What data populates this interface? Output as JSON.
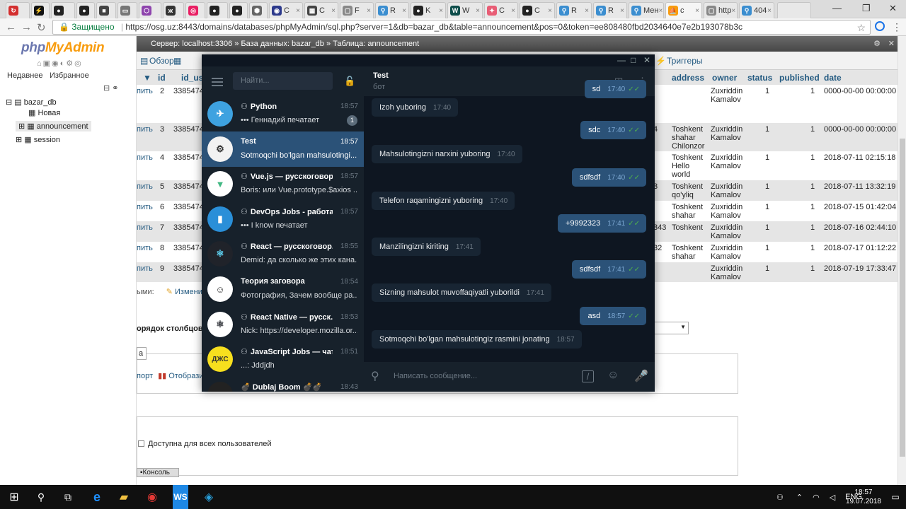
{
  "browser": {
    "tabs": [
      {
        "label": "",
        "color": "#d32f2f",
        "glyph": "↻",
        "active": false
      },
      {
        "label": "",
        "color": "#111",
        "glyph": "⚡",
        "active": false
      },
      {
        "label": "",
        "color": "#222",
        "glyph": "●",
        "active": false
      },
      {
        "label": "",
        "color": "#222",
        "glyph": "●",
        "active": false
      },
      {
        "label": "",
        "color": "#444",
        "glyph": "■",
        "active": false
      },
      {
        "label": "",
        "color": "#777",
        "glyph": "▭",
        "active": false
      },
      {
        "label": "",
        "color": "#8e44ad",
        "glyph": "⬡",
        "active": false
      },
      {
        "label": "",
        "color": "#333",
        "glyph": "ж",
        "active": false
      },
      {
        "label": "",
        "color": "#e91e63",
        "glyph": "◎",
        "active": false
      },
      {
        "label": "",
        "color": "#222",
        "glyph": "●",
        "active": false
      },
      {
        "label": "",
        "color": "#222",
        "glyph": "●",
        "active": false
      },
      {
        "label": "",
        "color": "#666",
        "glyph": "⬢",
        "active": false
      },
      {
        "label": "C",
        "color": "#2d3a8c",
        "glyph": "◉",
        "active": false
      },
      {
        "label": "C",
        "color": "#444",
        "glyph": "▦",
        "active": false
      },
      {
        "label": "F",
        "color": "#888",
        "glyph": "▢",
        "active": false
      },
      {
        "label": "R",
        "color": "#3b8ed0",
        "glyph": "⚲",
        "active": false
      },
      {
        "label": "K",
        "color": "#222",
        "glyph": "●",
        "active": false
      },
      {
        "label": "W",
        "color": "#0d4d4a",
        "glyph": "W",
        "active": false
      },
      {
        "label": "C",
        "color": "#e85d75",
        "glyph": "✦",
        "active": false
      },
      {
        "label": "C",
        "color": "#222",
        "glyph": "●",
        "active": false
      },
      {
        "label": "R",
        "color": "#3b8ed0",
        "glyph": "⚲",
        "active": false
      },
      {
        "label": "R",
        "color": "#3b8ed0",
        "glyph": "⚲",
        "active": false
      },
      {
        "label": "Мен",
        "color": "#3b8ed0",
        "glyph": "⚲",
        "active": false
      },
      {
        "label": "c",
        "color": "#f89c0e",
        "glyph": "⛵",
        "active": true
      },
      {
        "label": "http",
        "color": "#888",
        "glyph": "▢",
        "active": false
      },
      {
        "label": "404",
        "color": "#3b8ed0",
        "glyph": "⚲",
        "active": false
      }
    ],
    "secure_label": "Защищено",
    "url": "https://osg.uz:8443/domains/databases/phpMyAdmin/sql.php?server=1&db=bazar_db&table=announcement&pos=0&token=ee808480fbd2034640e7e2b193078b3c"
  },
  "pma": {
    "logo_a": "php",
    "logo_b": "MyAdmin",
    "recent": "Недавнее",
    "favorites": "Избранное",
    "tree": [
      "bazar_db",
      "Новая",
      "announcement",
      "session"
    ],
    "breadcrumb": "Сервер: localhost:3306 » База данных: bazar_db » Таблица: announcement",
    "tab_browse": "Обзор",
    "tab_triggers": "Триггеры",
    "columns": [
      "id",
      "id_us",
      "address",
      "owner",
      "status",
      "published",
      "date"
    ],
    "rows": [
      {
        "edit": "пить",
        "id": "2",
        "uid": "3385474",
        "addr_pre": "",
        "addr": "",
        "owner": "Zuxriddin Kamalov",
        "status": "1",
        "pub": "1",
        "date": "0000-00-00 00:00:00"
      },
      {
        "edit": "пить",
        "id": "3",
        "uid": "3385474",
        "addr_pre": "4",
        "addr": "Toshkent shahar Chilonzor",
        "owner": "Zuxriddin Kamalov",
        "status": "1",
        "pub": "1",
        "date": "0000-00-00 00:00:00"
      },
      {
        "edit": "пить",
        "id": "4",
        "uid": "3385474",
        "addr_pre": "",
        "addr": "Toshkent Hello world",
        "owner": "Zuxriddin Kamalov",
        "status": "1",
        "pub": "1",
        "date": "2018-07-11 02:15:18"
      },
      {
        "edit": "пить",
        "id": "5",
        "uid": "3385474",
        "addr_pre": "3",
        "addr": "Toshkent qo'yliq",
        "owner": "Zuxriddin Kamalov",
        "status": "1",
        "pub": "1",
        "date": "2018-07-11 13:32:19"
      },
      {
        "edit": "пить",
        "id": "6",
        "uid": "3385474",
        "addr_pre": "",
        "addr": "Toshkent shahar",
        "owner": "Zuxriddin Kamalov",
        "status": "1",
        "pub": "1",
        "date": "2018-07-15 01:42:04"
      },
      {
        "edit": "пить",
        "id": "7",
        "uid": "3385474",
        "addr_pre": "343",
        "addr": "Toshkent",
        "owner": "Zuxriddin Kamalov",
        "status": "1",
        "pub": "1",
        "date": "2018-07-16 02:44:10"
      },
      {
        "edit": "пить",
        "id": "8",
        "uid": "3385474",
        "addr_pre": "32",
        "addr": "Toshkent shahar",
        "owner": "Zuxriddin Kamalov",
        "status": "1",
        "pub": "1",
        "date": "2018-07-17 01:12:22"
      },
      {
        "edit": "пить",
        "id": "9",
        "uid": "3385474",
        "addr_pre": "",
        "addr": "",
        "owner": "Zuxriddin Kamalov",
        "status": "1",
        "pub": "1",
        "date": "2018-07-19 17:33:47"
      }
    ],
    "below_label": "ыми:",
    "below_edit": "Изменит",
    "order_label": "орядок столбцов",
    "box_a": "а",
    "export_label": "порт",
    "display_label": "Отобрази",
    "public_label": "Доступна для всех пользователей",
    "console_label": "Консоль"
  },
  "telegram": {
    "search_placeholder": "Найти...",
    "chats": [
      {
        "name": "Python",
        "group": true,
        "time": "18:57",
        "preview": "••• Геннадий печатает",
        "badge": "1",
        "avbg": "#3ea2e0",
        "avfg": "#fff",
        "avtext": "✈"
      },
      {
        "name": "Test",
        "group": false,
        "time": "18:57",
        "preview": "Sotmoqchi bo'lgan mahsulotingi...",
        "badge": "",
        "avbg": "#f2f2f2",
        "avfg": "#333",
        "avtext": "⚙",
        "sel": true
      },
      {
        "name": "Vue.js — русскоговор...",
        "group": true,
        "time": "18:57",
        "preview": "Boris: или Vue.prototype.$axios ...",
        "badge": "",
        "avbg": "#fff",
        "avfg": "#41b883",
        "avtext": "▼"
      },
      {
        "name": "DevOps Jobs - работа ...",
        "group": true,
        "time": "18:57",
        "preview": "••• I know печатает",
        "badge": "",
        "avbg": "#2a8fd8",
        "avfg": "#fff",
        "avtext": "▮"
      },
      {
        "name": "React — русскоговор...",
        "group": true,
        "time": "18:55",
        "preview": "Demid: да сколько же этих кана...",
        "badge": "",
        "avbg": "#20232a",
        "avfg": "#61dafb",
        "avtext": "⚛"
      },
      {
        "name": "Теория заговора",
        "group": false,
        "time": "18:54",
        "preview": "Фотография, Зачем вообще ра...",
        "badge": "",
        "avbg": "#fff",
        "avfg": "#333",
        "avtext": "☺"
      },
      {
        "name": "React Native — русск...",
        "group": true,
        "time": "18:53",
        "preview": "Nick: https://developer.mozilla.or...",
        "badge": "",
        "avbg": "#fff",
        "avfg": "#20232a",
        "avtext": "⚛"
      },
      {
        "name": "JavaScript Jobs — чат",
        "group": true,
        "time": "18:51",
        "preview": "...: Jddjdh",
        "badge": "",
        "avbg": "#f7df1e",
        "avfg": "#333",
        "avtext": "ДЖС"
      },
      {
        "name": "💣 Dublaj Boom 💣💣",
        "group": false,
        "time": "18:43",
        "preview": "",
        "badge": "",
        "avbg": "#222",
        "avfg": "#fff",
        "avtext": "●"
      }
    ],
    "chat_name": "Test",
    "chat_status": "бот",
    "messages": [
      {
        "dir": "out",
        "text": "sd",
        "time": "17:40"
      },
      {
        "dir": "in",
        "text": "Izoh yuboring",
        "time": "17:40"
      },
      {
        "dir": "out",
        "text": "sdc",
        "time": "17:40"
      },
      {
        "dir": "in",
        "text": "Mahsulotingizni narxini yuboring",
        "time": "17:40"
      },
      {
        "dir": "out",
        "text": "sdfsdf",
        "time": "17:40"
      },
      {
        "dir": "in",
        "text": "Telefon raqamingizni yuboring",
        "time": "17:40"
      },
      {
        "dir": "out",
        "text": "+9992323",
        "time": "17:41"
      },
      {
        "dir": "in",
        "text": "Manzilingizni kiriting",
        "time": "17:41"
      },
      {
        "dir": "out",
        "text": "sdfsdf",
        "time": "17:41"
      },
      {
        "dir": "in",
        "text": "Sizning mahsulot muvoffaqiyatli yuborildi",
        "time": "17:41"
      },
      {
        "dir": "out",
        "text": "asd",
        "time": "18:57"
      },
      {
        "dir": "in",
        "text": "Sotmoqchi bo'lgan mahsulotingiz rasmini jonating",
        "time": "18:57"
      }
    ],
    "composer_placeholder": "Написать сообщение..."
  },
  "taskbar": {
    "lang": "ENG",
    "time": "18:57",
    "date": "19.07.2018"
  }
}
